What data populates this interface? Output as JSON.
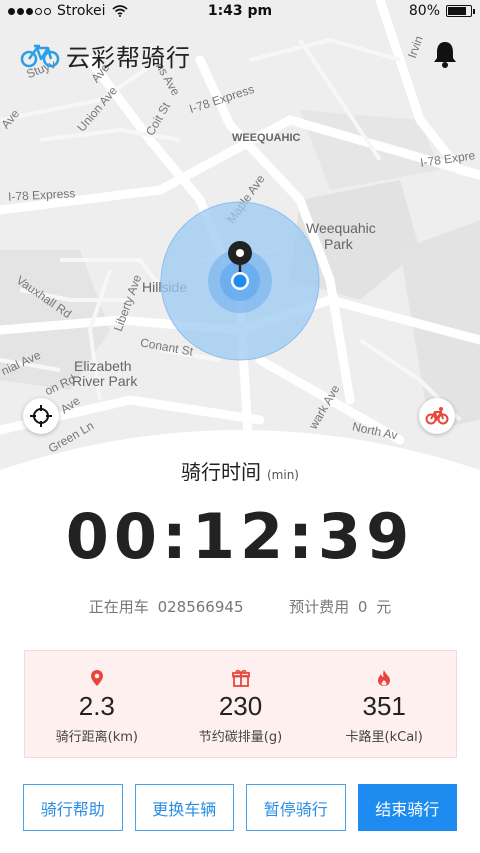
{
  "status_bar": {
    "carrier": "Strokei",
    "time": "1:43 pm",
    "battery": "80%"
  },
  "header": {
    "app_title": "云彩帮骑行",
    "logo_icon": "bicycle-icon",
    "notification_icon": "bell-icon"
  },
  "map": {
    "labels": [
      "Stuyv",
      "Union Ave",
      "Coit St",
      "I-78 Express",
      "WEEQUAHIC",
      "I-78 Expre",
      "I-78 Express",
      "Maple Ave",
      "Weequahic",
      "Park",
      "Hillside",
      "Vauxhall Rd",
      "Liberty Ave",
      "Conant St",
      "Elizabeth",
      "River Park",
      "nial Ave",
      "on Rd",
      "Ave",
      "Green Ln",
      "wark Ave",
      "North Av",
      "ns Ave",
      "Irvin",
      "Ave",
      "Ave"
    ],
    "locate_icon": "crosshair-icon",
    "bike_icon": "bike-icon"
  },
  "ride": {
    "title": "骑行时间",
    "unit": "(min)",
    "timer": "00:12:39",
    "bike_label": "正在用车",
    "bike_number": "028566945",
    "fee_label": "预计费用",
    "fee_value": "0",
    "fee_unit": "元"
  },
  "stats": [
    {
      "icon": "location-pin-icon",
      "value": "2.3",
      "label": "骑行距离(km)"
    },
    {
      "icon": "gift-box-icon",
      "value": "230",
      "label": "节约碳排量(g)"
    },
    {
      "icon": "flame-icon",
      "value": "351",
      "label": "卡路里(kCal)"
    }
  ],
  "actions": {
    "help": "骑行帮助",
    "change_bike": "更换车辆",
    "pause": "暂停骑行",
    "end": "结束骑行"
  },
  "colors": {
    "accent": "#1e8bf0",
    "stats_bg": "#fdf0ef",
    "icon_red": "#e8453c",
    "marker_blue": "#7db8f0"
  }
}
